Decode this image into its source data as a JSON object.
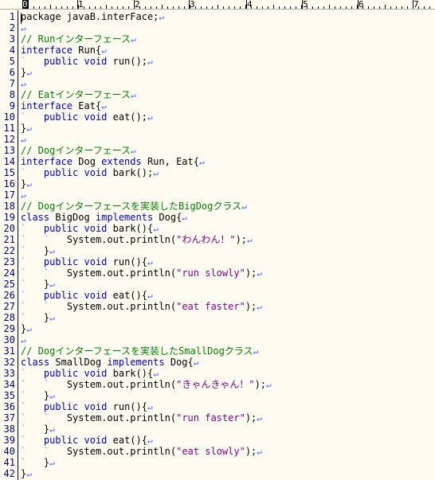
{
  "ruler": {
    "marks": [
      "0",
      "1",
      "2",
      "3",
      "4",
      "5",
      "6",
      "7"
    ]
  },
  "lines": [
    {
      "n": "1",
      "segs": [
        [
          "package javaB.interFace;",
          ""
        ]
      ]
    },
    {
      "n": "2",
      "segs": []
    },
    {
      "n": "3",
      "segs": [
        [
          "// Runインターフェース",
          "cm"
        ]
      ]
    },
    {
      "n": "4",
      "segs": [
        [
          "interface",
          "kw"
        ],
        [
          " Run{",
          ""
        ]
      ]
    },
    {
      "n": "5",
      "segs": [
        [
          "`",
          "tab"
        ],
        [
          "   ",
          ""
        ],
        [
          "public void",
          "kw"
        ],
        [
          " run();",
          ""
        ]
      ]
    },
    {
      "n": "6",
      "segs": [
        [
          "}",
          ""
        ]
      ]
    },
    {
      "n": "7",
      "segs": []
    },
    {
      "n": "8",
      "segs": [
        [
          "// Eatインターフェース",
          "cm"
        ]
      ]
    },
    {
      "n": "9",
      "segs": [
        [
          "interface",
          "kw"
        ],
        [
          " Eat{",
          ""
        ]
      ]
    },
    {
      "n": "10",
      "segs": [
        [
          "`",
          "tab"
        ],
        [
          "   ",
          ""
        ],
        [
          "public void",
          "kw"
        ],
        [
          " eat();",
          ""
        ]
      ]
    },
    {
      "n": "11",
      "segs": [
        [
          "}",
          ""
        ]
      ]
    },
    {
      "n": "12",
      "segs": []
    },
    {
      "n": "13",
      "segs": [
        [
          "// Dogインターフェース",
          "cm"
        ]
      ]
    },
    {
      "n": "14",
      "segs": [
        [
          "interface",
          "kw"
        ],
        [
          " Dog ",
          ""
        ],
        [
          "extends",
          "kw"
        ],
        [
          " Run, Eat{",
          ""
        ]
      ]
    },
    {
      "n": "15",
      "segs": [
        [
          "`",
          "tab"
        ],
        [
          "   ",
          ""
        ],
        [
          "public void",
          "kw"
        ],
        [
          " bark();",
          ""
        ]
      ]
    },
    {
      "n": "16",
      "segs": [
        [
          "}",
          ""
        ]
      ]
    },
    {
      "n": "17",
      "segs": []
    },
    {
      "n": "18",
      "segs": [
        [
          "// Dogインターフェースを実装したBigDogクラス",
          "cm"
        ]
      ]
    },
    {
      "n": "19",
      "segs": [
        [
          "class",
          "kw"
        ],
        [
          " BigDog ",
          ""
        ],
        [
          "implements",
          "kw"
        ],
        [
          " Dog{",
          ""
        ]
      ]
    },
    {
      "n": "20",
      "segs": [
        [
          "`",
          "tab"
        ],
        [
          "   ",
          ""
        ],
        [
          "public void",
          "kw"
        ],
        [
          " bark(){",
          ""
        ]
      ]
    },
    {
      "n": "21",
      "segs": [
        [
          "`",
          "tab"
        ],
        [
          "   ",
          ""
        ],
        [
          "`",
          "tab"
        ],
        [
          "   System.out.println(",
          ""
        ],
        [
          "\"わんわん！\"",
          "st"
        ],
        [
          ");",
          ""
        ]
      ]
    },
    {
      "n": "22",
      "segs": [
        [
          "`",
          "tab"
        ],
        [
          "   }",
          ""
        ]
      ]
    },
    {
      "n": "23",
      "segs": [
        [
          "`",
          "tab"
        ],
        [
          "   ",
          ""
        ],
        [
          "public void",
          "kw"
        ],
        [
          " run(){",
          ""
        ]
      ]
    },
    {
      "n": "24",
      "segs": [
        [
          "`",
          "tab"
        ],
        [
          "   ",
          ""
        ],
        [
          "`",
          "tab"
        ],
        [
          "   System.out.println(",
          ""
        ],
        [
          "\"run slowly\"",
          "st"
        ],
        [
          ");",
          ""
        ]
      ]
    },
    {
      "n": "25",
      "segs": [
        [
          "`",
          "tab"
        ],
        [
          "   }",
          ""
        ]
      ]
    },
    {
      "n": "26",
      "segs": [
        [
          "`",
          "tab"
        ],
        [
          "   ",
          ""
        ],
        [
          "public void",
          "kw"
        ],
        [
          " eat(){",
          ""
        ]
      ]
    },
    {
      "n": "27",
      "segs": [
        [
          "`",
          "tab"
        ],
        [
          "   ",
          ""
        ],
        [
          "`",
          "tab"
        ],
        [
          "   System.out.println(",
          ""
        ],
        [
          "\"eat faster\"",
          "st"
        ],
        [
          ");",
          ""
        ]
      ]
    },
    {
      "n": "28",
      "segs": [
        [
          "`",
          "tab"
        ],
        [
          "   }",
          ""
        ]
      ]
    },
    {
      "n": "29",
      "segs": [
        [
          "}",
          ""
        ]
      ]
    },
    {
      "n": "30",
      "segs": []
    },
    {
      "n": "31",
      "segs": [
        [
          "// Dogインターフェースを実装したSmallDogクラス",
          "cm"
        ]
      ]
    },
    {
      "n": "32",
      "segs": [
        [
          "class",
          "kw"
        ],
        [
          " SmallDog ",
          ""
        ],
        [
          "implements",
          "kw"
        ],
        [
          " Dog{",
          ""
        ]
      ]
    },
    {
      "n": "33",
      "segs": [
        [
          "`",
          "tab"
        ],
        [
          "   ",
          ""
        ],
        [
          "public void",
          "kw"
        ],
        [
          " bark(){",
          ""
        ]
      ]
    },
    {
      "n": "34",
      "segs": [
        [
          "`",
          "tab"
        ],
        [
          "   ",
          ""
        ],
        [
          "`",
          "tab"
        ],
        [
          "   System.out.println(",
          ""
        ],
        [
          "\"きゃんきゃん！\"",
          "st"
        ],
        [
          ");",
          ""
        ]
      ]
    },
    {
      "n": "35",
      "segs": [
        [
          "`",
          "tab"
        ],
        [
          "   }",
          ""
        ]
      ]
    },
    {
      "n": "36",
      "segs": [
        [
          "`",
          "tab"
        ],
        [
          "   ",
          ""
        ],
        [
          "public void",
          "kw"
        ],
        [
          " run(){",
          ""
        ]
      ]
    },
    {
      "n": "37",
      "segs": [
        [
          "`",
          "tab"
        ],
        [
          "   ",
          ""
        ],
        [
          "`",
          "tab"
        ],
        [
          "   System.out.println(",
          ""
        ],
        [
          "\"run faster\"",
          "st"
        ],
        [
          ");",
          ""
        ]
      ]
    },
    {
      "n": "38",
      "segs": [
        [
          "`",
          "tab"
        ],
        [
          "   }",
          ""
        ]
      ]
    },
    {
      "n": "39",
      "segs": [
        [
          "`",
          "tab"
        ],
        [
          "   ",
          ""
        ],
        [
          "public void",
          "kw"
        ],
        [
          " eat(){",
          ""
        ]
      ]
    },
    {
      "n": "40",
      "segs": [
        [
          "`",
          "tab"
        ],
        [
          "   ",
          ""
        ],
        [
          "`",
          "tab"
        ],
        [
          "   System.out.println(",
          ""
        ],
        [
          "\"eat slowly\"",
          "st"
        ],
        [
          ");",
          ""
        ]
      ]
    },
    {
      "n": "41",
      "segs": [
        [
          "`",
          "tab"
        ],
        [
          "   }",
          ""
        ]
      ]
    },
    {
      "n": "42",
      "segs": [
        [
          "}",
          ""
        ]
      ]
    }
  ],
  "newline_glyph": "↵",
  "colors": {
    "background": "#fefcf0",
    "keyword": "#0000c8",
    "comment": "#008000",
    "string": "#800080",
    "line_number": "#000080",
    "newline_mark": "#4060ff"
  }
}
